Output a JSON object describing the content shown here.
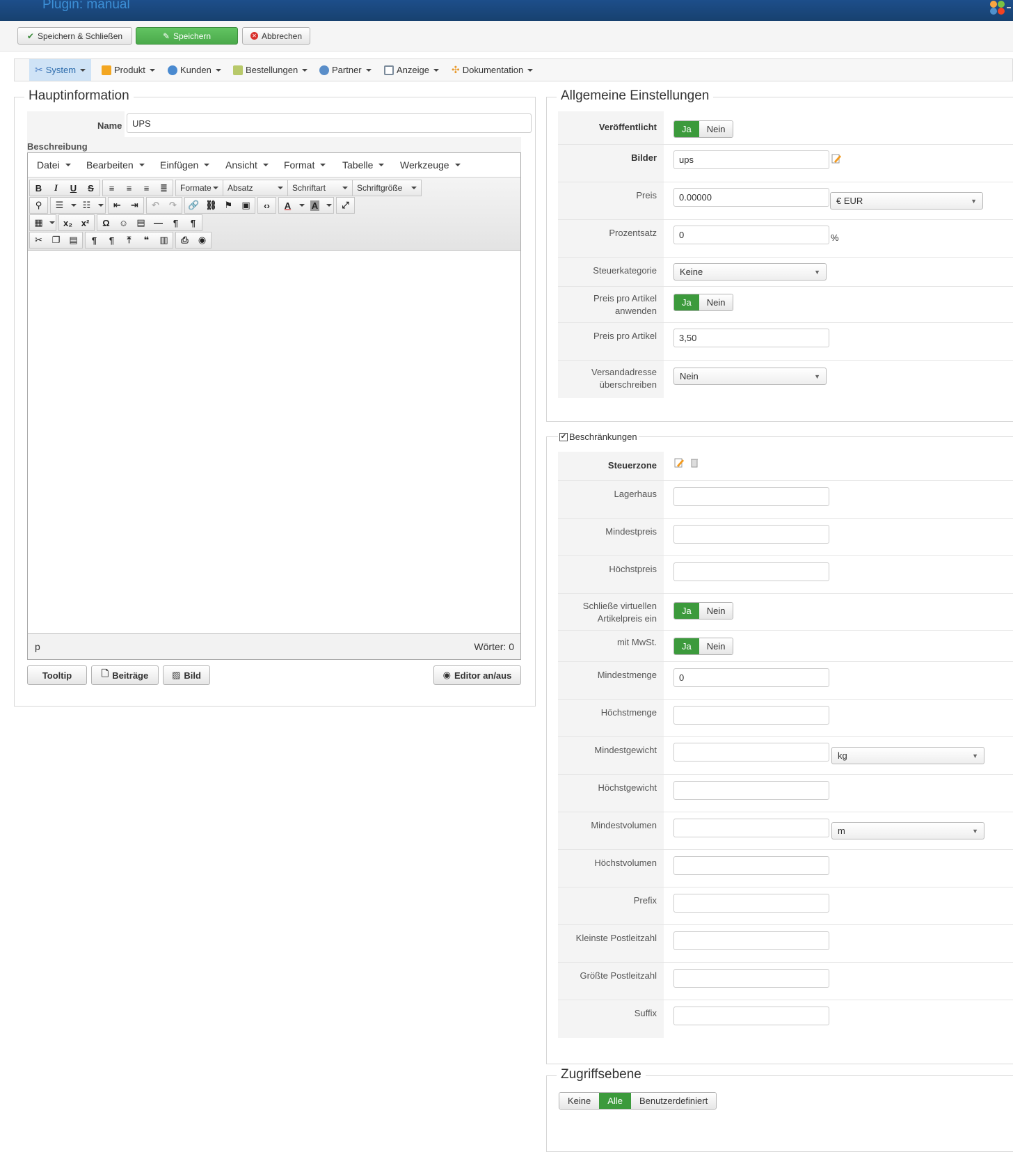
{
  "header": {
    "title": "Plugin: manual"
  },
  "toolbar": {
    "save_close": "Speichern & Schließen",
    "save": "Speichern",
    "cancel": "Abbrechen"
  },
  "menu": {
    "items": [
      "System",
      "Produkt",
      "Kunden",
      "Bestellungen",
      "Partner",
      "Anzeige",
      "Dokumentation"
    ],
    "active": "System"
  },
  "main_info": {
    "legend": "Hauptinformation",
    "name_label": "Name",
    "name_value": "UPS",
    "description_label": "Beschreibung",
    "editor": {
      "menus": [
        "Datei",
        "Bearbeiten",
        "Einfügen",
        "Ansicht",
        "Format",
        "Tabelle",
        "Werkzeuge"
      ],
      "selects": [
        "Formate",
        "Absatz",
        "Schriftart",
        "Schriftgröße"
      ],
      "status_path": "p",
      "word_count": "Wörter: 0"
    },
    "buttons": {
      "tooltip": "Tooltip",
      "articles": "Beiträge",
      "image": "Bild",
      "toggle_editor": "Editor an/aus"
    }
  },
  "general": {
    "legend": "Allgemeine Einstellungen",
    "published_label": "Veröffentlicht",
    "yes": "Ja",
    "no": "Nein",
    "images_label": "Bilder",
    "images_value": "ups",
    "price_label": "Preis",
    "price_value": "0.00000",
    "currency": "€ EUR",
    "percent_label": "Prozentsatz",
    "percent_value": "0",
    "percent_sign": "%",
    "tax_label": "Steuerkategorie",
    "tax_value": "Keine",
    "per_item_apply_label": "Preis pro Artikel anwenden",
    "per_item_price_label": "Preis pro Artikel",
    "per_item_price_value": "3,50",
    "override_label": "Versandadresse überschreiben",
    "override_value": "Nein"
  },
  "restrictions": {
    "legend": "Beschränkungen",
    "tax_zone_label": "Steuerzone",
    "warehouse_label": "Lagerhaus",
    "min_price_label": "Mindestpreis",
    "max_price_label": "Höchstpreis",
    "include_virtual_label": "Schließe virtuellen Artikelpreis ein",
    "with_vat_label": "mit MwSt.",
    "min_qty_label": "Mindestmenge",
    "min_qty_value": "0",
    "max_qty_label": "Höchstmenge",
    "min_weight_label": "Mindestgewicht",
    "weight_unit": "kg",
    "max_weight_label": "Höchstgewicht",
    "min_volume_label": "Mindestvolumen",
    "volume_unit": "m",
    "max_volume_label": "Höchstvolumen",
    "prefix_label": "Prefix",
    "min_zip_label": "Kleinste Postleitzahl",
    "max_zip_label": "Größte Postleitzahl",
    "suffix_label": "Suffix"
  },
  "access": {
    "legend": "Zugriffsebene",
    "none": "Keine",
    "all": "Alle",
    "custom": "Benutzerdefiniert"
  }
}
